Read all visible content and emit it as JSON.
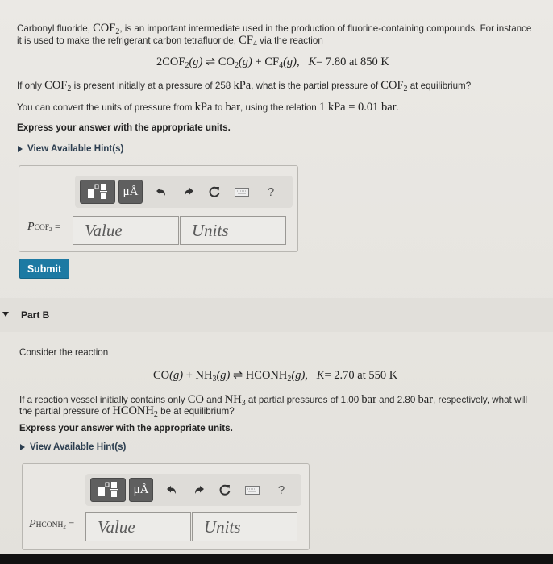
{
  "part_a": {
    "intro_line1_pre": "Carbonyl fluoride, ",
    "intro_line1_formula": "COF",
    "intro_line1_formula_sub": "2",
    "intro_line1_post": ", is an important intermediate used in the production of fluorine-containing compounds. For instance",
    "intro_line2_pre": "it is used to make the refrigerant carbon tetrafluoride, ",
    "intro_line2_formula": "CF",
    "intro_line2_formula_sub": "4",
    "intro_line2_post": " via the reaction",
    "equation": {
      "reactant": "2COF",
      "reactant_sub": "2",
      "reactant_state": "(g)",
      "arrow": "⇌",
      "product1": "CO",
      "product1_sub": "2",
      "product1_state": "(g)",
      "plus": "+",
      "product2": "CF",
      "product2_sub": "4",
      "product2_state": "(g),",
      "k_label": "K",
      "k_text": "= 7.80 at 850 K"
    },
    "question_pre": "If only ",
    "question_formula1": "COF",
    "question_formula1_sub": "2",
    "question_mid": " is present initially at a pressure of 258 ",
    "question_unit": "kPa",
    "question_mid2": ", what is the partial pressure of ",
    "question_formula2": "COF",
    "question_formula2_sub": "2",
    "question_post": " at equilibrium?",
    "convert_pre": "You can convert the units of pressure from ",
    "convert_unit1": "kPa",
    "convert_mid": " to ",
    "convert_unit2": "bar",
    "convert_mid2": ", using the relation ",
    "convert_relation": "1 kPa = 0.01 bar",
    "convert_post": ".",
    "express": "Express your answer with the appropriate units.",
    "hint_label": "View Available Hint(s)",
    "answer_label_var": "P",
    "answer_label_sub": "COF",
    "answer_label_subsub": "2",
    "answer_label_eq": "=",
    "value_placeholder": "Value",
    "units_placeholder": "Units",
    "submit_label": "Submit"
  },
  "toolbar": {
    "templates_icon": "templates-icon",
    "units_label": "μÅ",
    "undo_glyph": "↶",
    "redo_glyph": "↷",
    "reset_glyph": "↻",
    "help_glyph": "?"
  },
  "part_b": {
    "header": "Part B",
    "consider": "Consider the reaction",
    "equation": {
      "r1": "CO",
      "r1_state": "(g)",
      "plus": "+",
      "r2": "NH",
      "r2_sub": "3",
      "r2_state": "(g)",
      "arrow": "⇌",
      "p1": "HCONH",
      "p1_sub": "2",
      "p1_state": "(g),",
      "k_label": "K",
      "k_text": "= 2.70 at 550 K"
    },
    "q_line1_pre": "If a reaction vessel initially contains only ",
    "q_f1": "CO",
    "q_and": " and ",
    "q_f2": "NH",
    "q_f2_sub": "3",
    "q_line1_mid": " at partial pressures of 1.00 ",
    "q_unit1": "bar",
    "q_line1_mid2": " and 2.80 ",
    "q_unit2": "bar",
    "q_line1_post": ", respectively, what will",
    "q_line2_pre": "the partial pressure of ",
    "q_f3": "HCONH",
    "q_f3_sub": "2",
    "q_line2_post": " be at equilibrium?",
    "express": "Express your answer with the appropriate units.",
    "hint_label": "View Available Hint(s)",
    "answer_label_var": "P",
    "answer_label_sub": "HCONH",
    "answer_label_subsub": "2",
    "answer_label_eq": "=",
    "value_placeholder": "Value",
    "units_placeholder": "Units"
  },
  "colors": {
    "submit_bg": "#1d7aa3",
    "toolbar_dark": "#5f5f5f",
    "hint_text": "#2c3e50"
  }
}
